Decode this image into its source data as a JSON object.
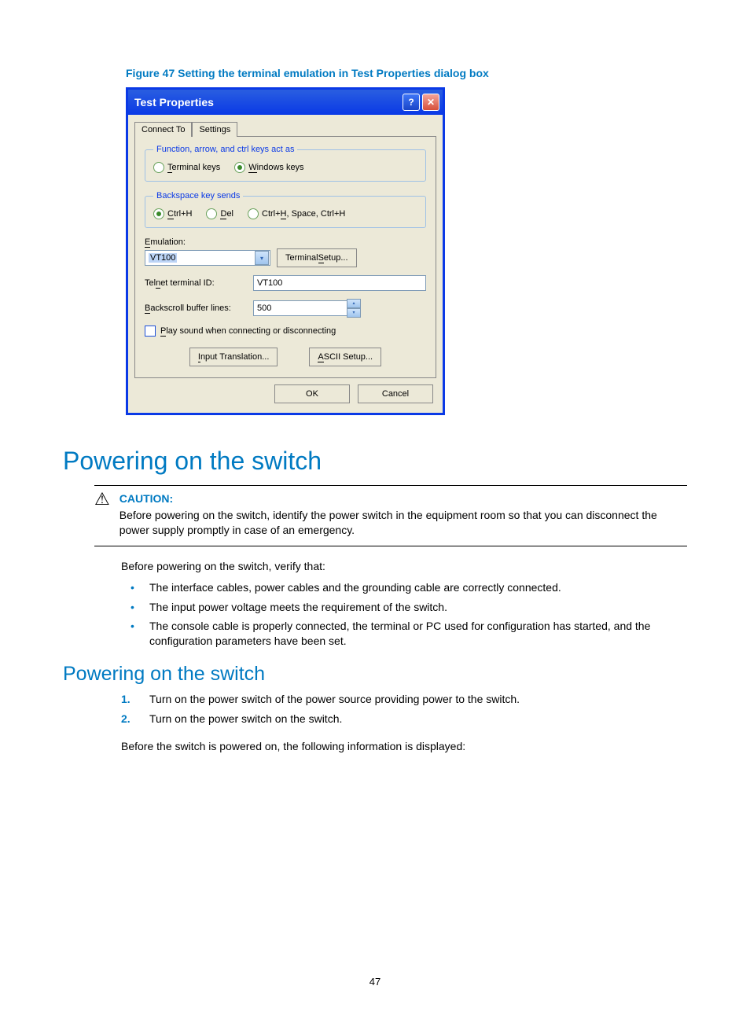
{
  "figure_caption": "Figure 47 Setting the terminal emulation in Test Properties dialog box",
  "dialog": {
    "title": "Test Properties",
    "help_btn": "?",
    "close_btn": "✕",
    "tabs": {
      "connect_to": "Connect To",
      "settings": "Settings"
    },
    "fnkeys": {
      "legend": "Function, arrow, and ctrl keys act as",
      "terminal": "Terminal keys",
      "windows": "Windows keys",
      "terminal_u": "T",
      "windows_u": "W"
    },
    "backspace": {
      "legend": "Backspace key sends",
      "ctrlh": "Ctrl+H",
      "del": "Del",
      "ctrlhspace": "Ctrl+H, Space, Ctrl+H",
      "c_u": "C",
      "d_u": "D",
      "h_u": "H"
    },
    "emulation_label": "Emulation:",
    "emulation_value": "VT100",
    "terminal_setup_btn": "Terminal Setup...",
    "telnet_label": "Telnet terminal ID:",
    "telnet_value": "VT100",
    "backscroll_label": "Backscroll buffer lines:",
    "backscroll_value": "500",
    "playsound": "Play sound when connecting or disconnecting",
    "input_translation_btn": "Input Translation...",
    "ascii_setup_btn": "ASCII Setup...",
    "ok_btn": "OK",
    "cancel_btn": "Cancel"
  },
  "section_title": "Powering on the switch",
  "caution_label": "CAUTION:",
  "caution_text": "Before powering on the switch, identify the power switch in the equipment room so that you can disconnect the power supply promptly in case of an emergency.",
  "intro_text": "Before powering on the switch, verify that:",
  "bullets": [
    "The interface cables, power cables and the grounding cable are correctly connected.",
    "The input power voltage meets the requirement of the switch.",
    "The console cable is properly connected, the terminal or PC used for configuration has started, and the configuration parameters have been set."
  ],
  "subsection_title": "Powering on the switch",
  "steps": [
    "Turn on the power switch of the power source providing power to the switch.",
    "Turn on the power switch on the switch."
  ],
  "closing_text": "Before the switch is powered on, the following information is displayed:",
  "page_number": "47"
}
